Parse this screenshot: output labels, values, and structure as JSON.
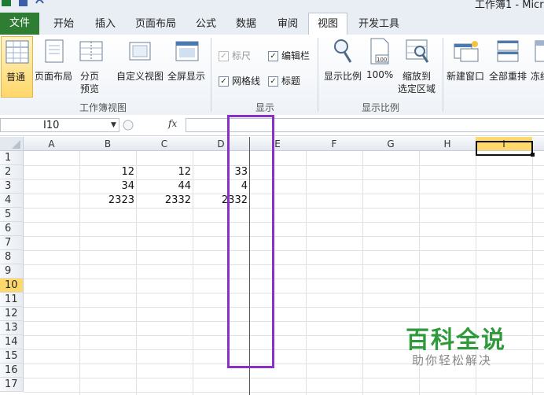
{
  "window": {
    "title": "工作簿1 - Micro"
  },
  "tabs": [
    "文件",
    "开始",
    "插入",
    "页面布局",
    "公式",
    "数据",
    "审阅",
    "视图",
    "开发工具"
  ],
  "active_tab": "视图",
  "ribbon": {
    "normal": "普通",
    "page_layout": "页面布局",
    "page_break_1": "分页",
    "page_break_2": "预览",
    "custom_views": "自定义视图",
    "full_screen": "全屏显示",
    "group_workbook_views": "工作簿视图",
    "ruler": "标尺",
    "formula_bar": "编辑栏",
    "gridlines": "网格线",
    "headings": "标题",
    "group_show": "显示",
    "zoom": "显示比例",
    "zoom_100": "100%",
    "zoom_100_icon_text": "100",
    "zoom_selection_1": "缩放到",
    "zoom_selection_2": "选定区域",
    "group_zoom": "显示比例",
    "new_window": "新建窗口",
    "arrange_all": "全部重排",
    "freeze": "冻结"
  },
  "formula_bar": {
    "name_box": "I10",
    "fx": "fx",
    "value": ""
  },
  "columns": [
    "A",
    "B",
    "C",
    "D",
    "E",
    "F",
    "G",
    "H",
    "I"
  ],
  "rows": [
    "1",
    "2",
    "3",
    "4",
    "5",
    "6",
    "7",
    "8",
    "9",
    "10",
    "11",
    "12",
    "13",
    "14",
    "15",
    "16",
    "17"
  ],
  "cells": {
    "B2": "12",
    "C2": "12",
    "D2": "33",
    "B3": "34",
    "C3": "44",
    "D3": "4",
    "B4": "2323",
    "C4": "2332",
    "D4": "2332"
  },
  "selected_cell": "I10",
  "annotation_color": "#8b2fc9",
  "watermark": {
    "title": "百科全说",
    "subtitle": "助你轻松解决"
  }
}
